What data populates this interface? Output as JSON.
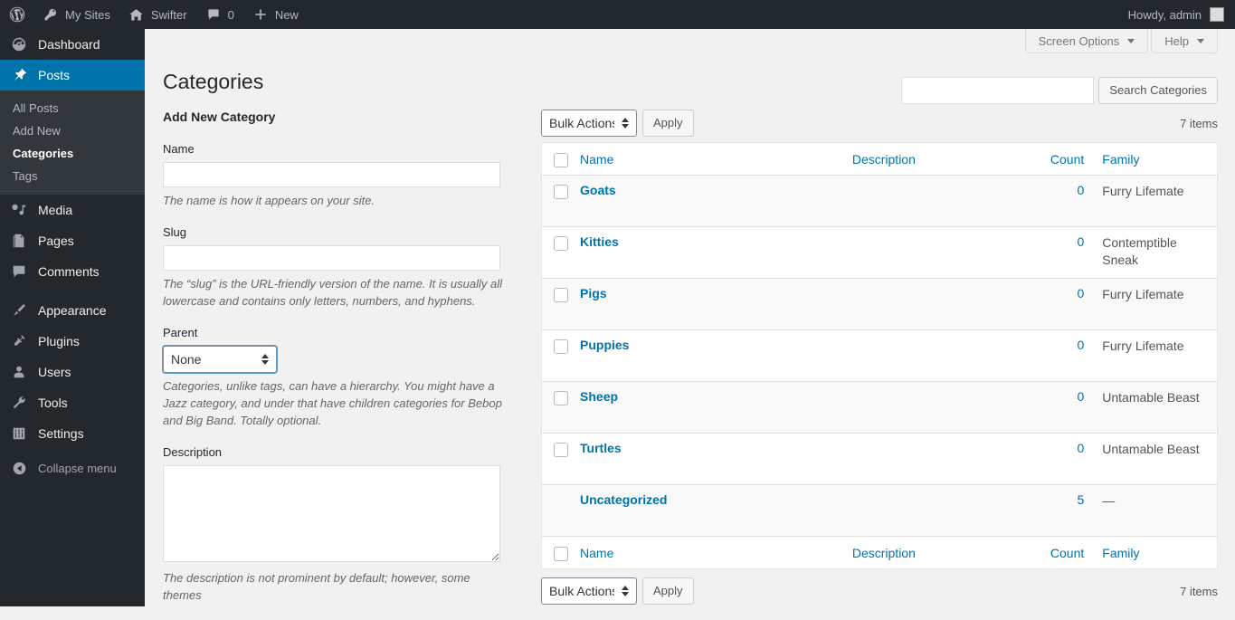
{
  "adminbar": {
    "items": [
      {
        "icon": "wordpress-logo-icon",
        "label": ""
      },
      {
        "icon": "key-icon",
        "label": "My Sites"
      },
      {
        "icon": "home-icon",
        "label": "Swifter"
      },
      {
        "icon": "comment-bubble-icon",
        "label": "0"
      },
      {
        "icon": "plus-icon",
        "label": "New"
      }
    ],
    "howdy": "Howdy, admin"
  },
  "sidebar": {
    "items": [
      {
        "label": "Dashboard",
        "icon": "dashboard-icon",
        "current": false
      },
      {
        "label": "Posts",
        "icon": "pin-icon",
        "current": true
      },
      {
        "label": "Media",
        "icon": "media-icon",
        "current": false
      },
      {
        "label": "Pages",
        "icon": "pages-icon",
        "current": false
      },
      {
        "label": "Comments",
        "icon": "comment-bubble-icon",
        "current": false
      },
      {
        "label": "Appearance",
        "icon": "paintbrush-icon",
        "current": false
      },
      {
        "label": "Plugins",
        "icon": "plug-icon",
        "current": false
      },
      {
        "label": "Users",
        "icon": "user-icon",
        "current": false
      },
      {
        "label": "Tools",
        "icon": "wrench-icon",
        "current": false
      },
      {
        "label": "Settings",
        "icon": "settings-sliders-icon",
        "current": false
      }
    ],
    "posts_submenu": [
      {
        "label": "All Posts",
        "current": false
      },
      {
        "label": "Add New",
        "current": false
      },
      {
        "label": "Categories",
        "current": true
      },
      {
        "label": "Tags",
        "current": false
      }
    ],
    "collapse": "Collapse menu"
  },
  "screen_meta": {
    "screen_options": "Screen Options",
    "help": "Help"
  },
  "page": {
    "title": "Categories"
  },
  "search": {
    "value": "",
    "button": "Search Categories"
  },
  "form": {
    "heading": "Add New Category",
    "name_label": "Name",
    "name_value": "",
    "name_help": "The name is how it appears on your site.",
    "slug_label": "Slug",
    "slug_value": "",
    "slug_help": "The “slug” is the URL-friendly version of the name. It is usually all lowercase and contains only letters, numbers, and hyphens.",
    "parent_label": "Parent",
    "parent_value": "None",
    "parent_help": "Categories, unlike tags, can have a hierarchy. You might have a Jazz category, and under that have children categories for Bebop and Big Band. Totally optional.",
    "description_label": "Description",
    "description_value": "",
    "description_help": "The description is not prominent by default; however, some themes"
  },
  "list": {
    "bulk_actions": "Bulk Actions",
    "apply": "Apply",
    "items_count": "7 items",
    "columns": {
      "name": "Name",
      "description": "Description",
      "count": "Count",
      "family": "Family"
    },
    "rows": [
      {
        "name": "Goats",
        "description": "",
        "count": "0",
        "family": "Furry Lifemate",
        "checkbox": true
      },
      {
        "name": "Kitties",
        "description": "",
        "count": "0",
        "family": "Contemptible Sneak",
        "checkbox": true
      },
      {
        "name": "Pigs",
        "description": "",
        "count": "0",
        "family": "Furry Lifemate",
        "checkbox": true
      },
      {
        "name": "Puppies",
        "description": "",
        "count": "0",
        "family": "Furry Lifemate",
        "checkbox": true
      },
      {
        "name": "Sheep",
        "description": "",
        "count": "0",
        "family": "Untamable Beast",
        "checkbox": true
      },
      {
        "name": "Turtles",
        "description": "",
        "count": "0",
        "family": "Untamable Beast",
        "checkbox": true
      },
      {
        "name": "Uncategorized",
        "description": "",
        "count": "5",
        "family": "—",
        "checkbox": false
      }
    ]
  },
  "colors": {
    "accent": "#0073aa",
    "adminbar_bg": "#23282d",
    "sidebar_bg": "#23282d",
    "submenu_bg": "#32373c",
    "content_bg": "#f1f1f1"
  }
}
